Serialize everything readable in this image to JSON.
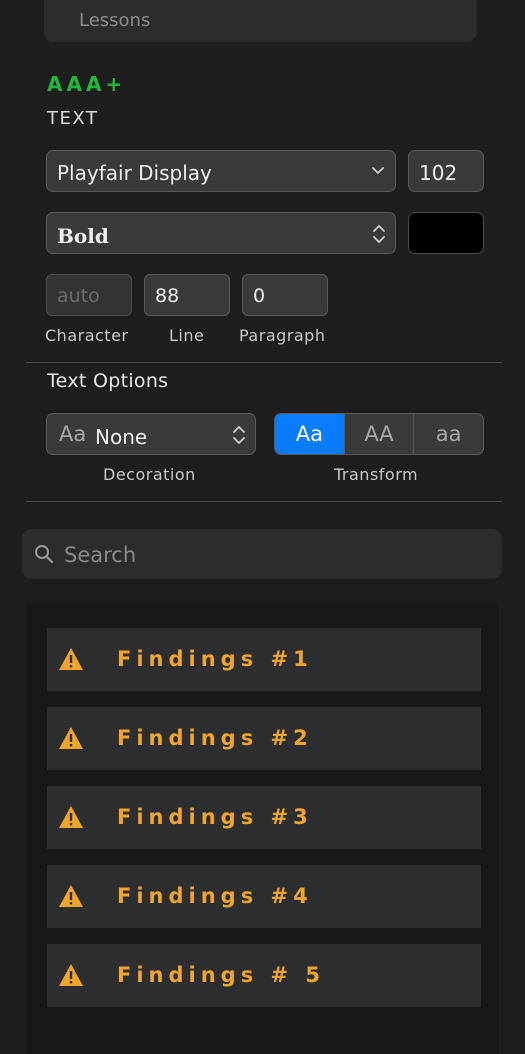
{
  "top_item": {
    "label": "Lessons"
  },
  "contrast_rating": "AAA+",
  "text_section": {
    "heading": "TEXT",
    "font_family": "Playfair Display",
    "font_size": "102",
    "font_weight": "Bold",
    "color": "#000000",
    "spacing": {
      "character": {
        "value": "auto",
        "label": "Character"
      },
      "line": {
        "value": "88",
        "label": "Line"
      },
      "paragraph": {
        "value": "0",
        "label": "Paragraph"
      }
    }
  },
  "text_options": {
    "heading": "Text Options",
    "decoration": {
      "icon_text": "Aa",
      "value": "None",
      "label": "Decoration"
    },
    "transform": {
      "label": "Transform",
      "options": [
        "Aa",
        "AA",
        "aa"
      ],
      "selected": 0
    }
  },
  "search": {
    "placeholder": "Search"
  },
  "findings": [
    {
      "label": "Findings #1",
      "icon": "warning-icon"
    },
    {
      "label": "Findings #2",
      "icon": "warning-icon"
    },
    {
      "label": "Findings #3",
      "icon": "warning-icon"
    },
    {
      "label": "Findings #4",
      "icon": "warning-icon"
    },
    {
      "label": "Findings # 5",
      "icon": "warning-icon"
    }
  ],
  "colors": {
    "accent": "#0a7cff",
    "rating_green": "#1fb83a",
    "warning": "#f0a52a"
  }
}
